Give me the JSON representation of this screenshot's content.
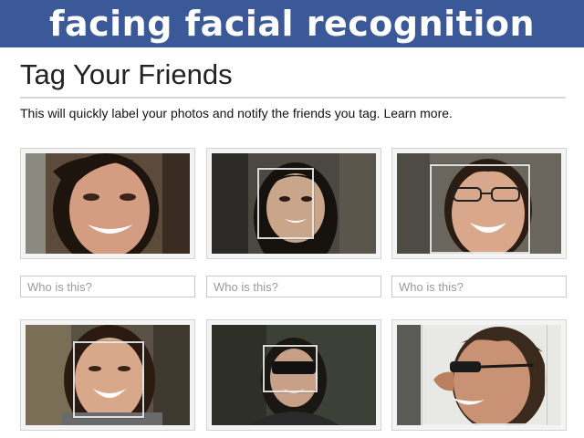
{
  "banner": {
    "text": "facing facial recognition"
  },
  "dialog": {
    "title": "Tag Your Friends",
    "description": "This will quickly label your photos and notify the friends you tag.",
    "learn_more": "Learn more."
  },
  "photos": [
    {
      "placeholder": "Who is this?"
    },
    {
      "placeholder": "Who is this?"
    },
    {
      "placeholder": "Who is this?"
    },
    {
      "placeholder": ""
    },
    {
      "placeholder": ""
    },
    {
      "placeholder": ""
    }
  ],
  "colors": {
    "banner_bg": "#3b5998",
    "banner_text": "#ffffff",
    "input_border": "#c9c9c9",
    "placeholder_text": "#9a9a9a"
  }
}
